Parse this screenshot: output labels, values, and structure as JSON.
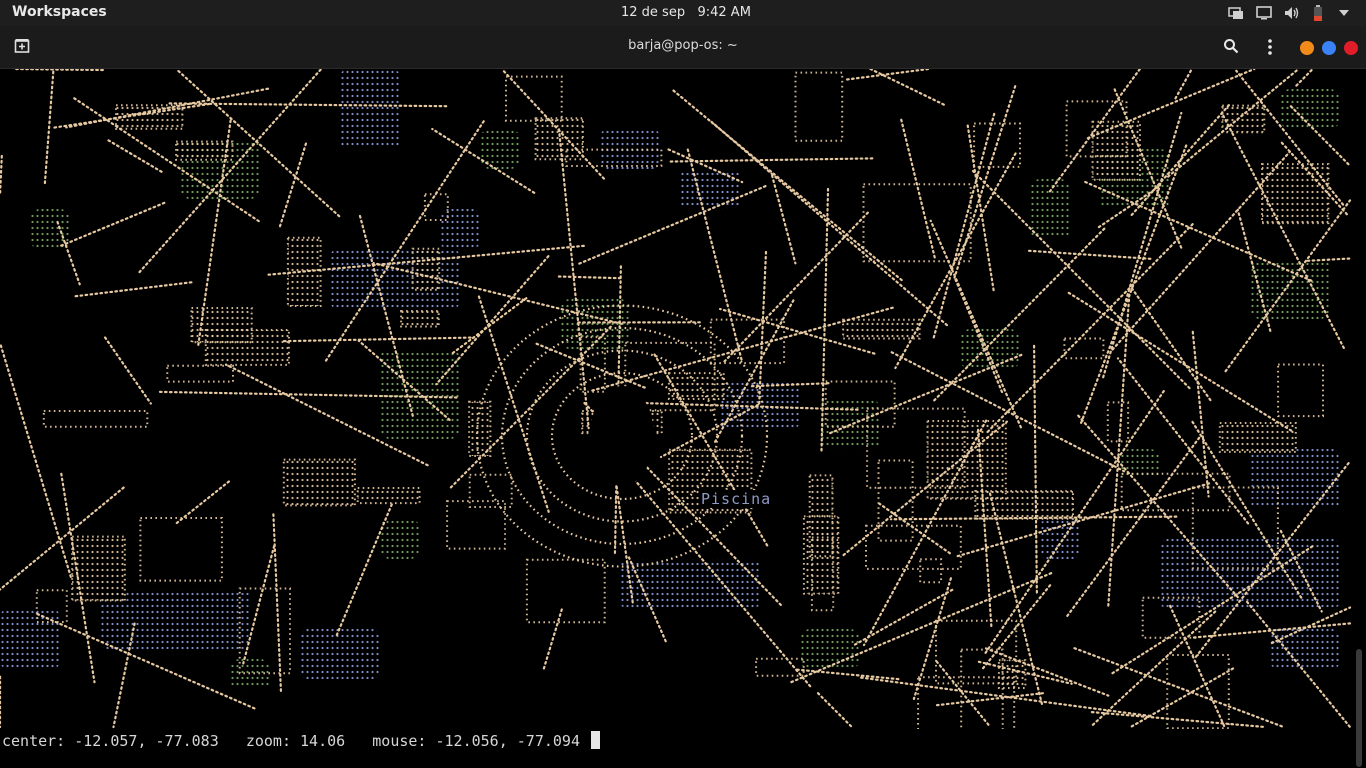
{
  "topbar": {
    "workspaces_label": "Workspaces",
    "clock": "12 de sep   9:42 AM"
  },
  "terminal": {
    "title": "barja@pop-os: ~",
    "window_controls": {
      "minimize_color": "#f38b1b",
      "maximize_color": "#3b82f6",
      "close_color": "#e11d2a"
    }
  },
  "map": {
    "label": "Piscina",
    "colors": {
      "streets": "#e7c9a1",
      "water": "#7f8dc7",
      "parks": "#6f9a5a"
    }
  },
  "status": {
    "center_label": "center:",
    "center_value": "-12.057, -77.083",
    "zoom_label": "zoom:",
    "zoom_value": "14.06",
    "mouse_label": "mouse:",
    "mouse_value": "-12.056, -77.094"
  }
}
